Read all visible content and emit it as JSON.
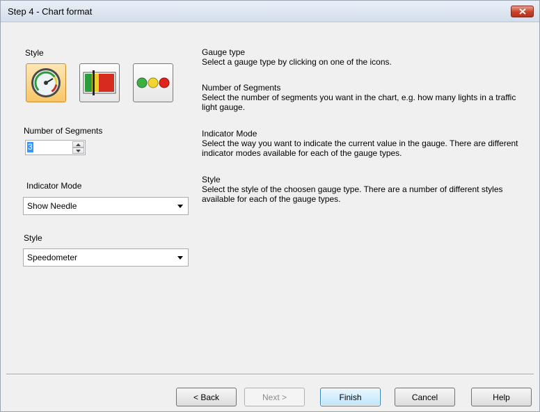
{
  "window": {
    "title": "Step 4 - Chart format"
  },
  "left": {
    "style_heading": "Style",
    "style_icons": [
      {
        "name": "gauge-icon",
        "selected": true
      },
      {
        "name": "linear-gauge-icon",
        "selected": false
      },
      {
        "name": "traffic-light-icon",
        "selected": false
      }
    ],
    "segments_label": "Number of Segments",
    "segments_value": "3",
    "indicator_label": "Indicator Mode",
    "indicator_value": "Show Needle",
    "style_label": "Style",
    "style_value": "Speedometer"
  },
  "descriptions": {
    "gauge_type_title": "Gauge type",
    "gauge_type_text": "Select a gauge type by clicking on one of the icons.",
    "segments_title": "Number of Segments",
    "segments_text": "Select the number of segments you want in the chart, e.g. how many lights in a traffic light gauge.",
    "indicator_title": "Indicator Mode",
    "indicator_text": "Select the way you want to indicate the current value in the gauge. There are different indicator modes available for each of the gauge types.",
    "style_title": "Style",
    "style_text": "Select the style of the choosen gauge type. There are a number of different styles available for each of the gauge types."
  },
  "buttons": {
    "back": "< Back",
    "next": "Next >",
    "finish": "Finish",
    "cancel": "Cancel",
    "help": "Help"
  },
  "colors": {
    "selection": "#3399ff",
    "close_button": "#c9402a",
    "selected_icon_bg": "#f7c768"
  }
}
